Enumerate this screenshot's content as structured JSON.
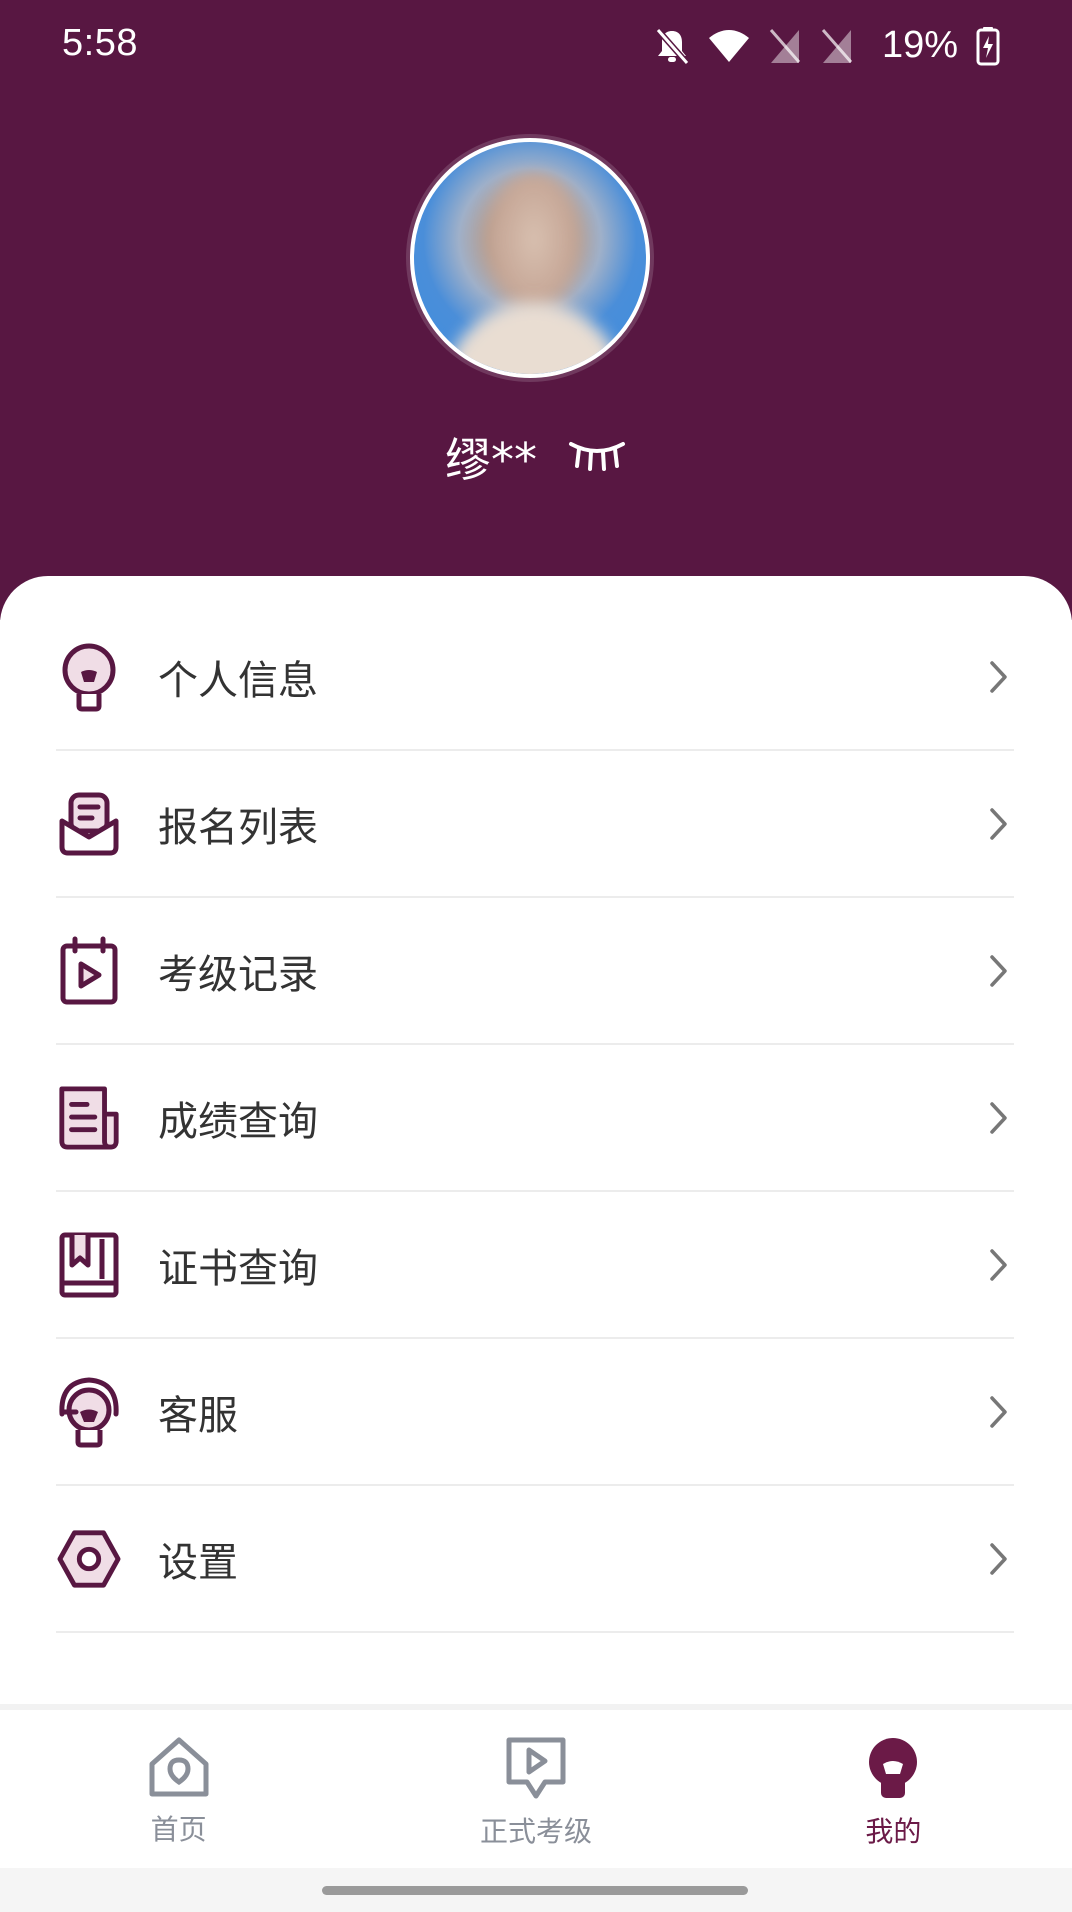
{
  "status_bar": {
    "time": "5:58",
    "battery": "19%",
    "icons": [
      "bell-off-icon",
      "wifi-icon",
      "no-sim-icon",
      "no-sim-icon",
      "battery-charging-icon"
    ]
  },
  "profile": {
    "name": "缪**",
    "visibility_icon": "eye-closed-icon"
  },
  "menu": {
    "items": [
      {
        "label": "个人信息",
        "icon": "person-info-icon"
      },
      {
        "label": "报名列表",
        "icon": "registration-list-icon"
      },
      {
        "label": "考级记录",
        "icon": "exam-record-icon"
      },
      {
        "label": "成绩查询",
        "icon": "score-query-icon"
      },
      {
        "label": "证书查询",
        "icon": "certificate-query-icon"
      },
      {
        "label": "客服",
        "icon": "customer-service-icon"
      },
      {
        "label": "设置",
        "icon": "settings-icon"
      }
    ]
  },
  "bottom_nav": {
    "items": [
      {
        "label": "首页",
        "icon": "home-icon",
        "active": false
      },
      {
        "label": "正式考级",
        "icon": "exam-play-icon",
        "active": false
      },
      {
        "label": "我的",
        "icon": "profile-icon",
        "active": true
      }
    ]
  },
  "colors": {
    "header_bg": "#581742",
    "accent": "#6b1a47",
    "icon_fill": "#f0dde6",
    "nav_inactive": "#8a8f99"
  }
}
